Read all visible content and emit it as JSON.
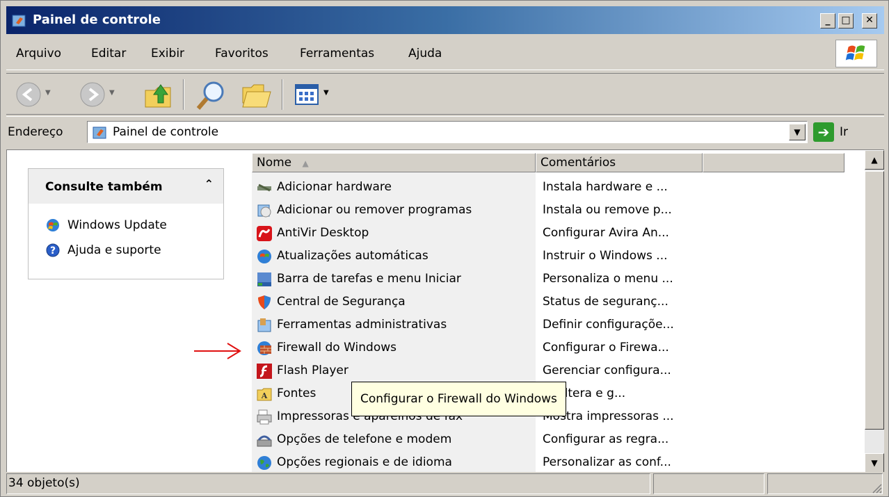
{
  "window": {
    "title": "Painel de controle"
  },
  "menu": [
    "Arquivo",
    "Editar",
    "Exibir",
    "Favoritos",
    "Ferramentas",
    "Ajuda"
  ],
  "toolbar": {
    "icons": [
      "back-icon",
      "forward-icon",
      "up-folder-icon",
      "search-icon",
      "folders-icon",
      "views-icon"
    ]
  },
  "address": {
    "label": "Endereço",
    "value": "Painel de controle",
    "go": "Ir"
  },
  "see_also": {
    "title": "Consulte também",
    "links": [
      "Windows Update",
      "Ajuda e suporte"
    ]
  },
  "columns": {
    "name": "Nome",
    "comments": "Comentários"
  },
  "items": [
    {
      "name": "Adicionar hardware",
      "comment": "Instala hardware e ..."
    },
    {
      "name": "Adicionar ou remover programas",
      "comment": "Instala ou remove p..."
    },
    {
      "name": "AntiVir Desktop",
      "comment": "Configurar Avira An..."
    },
    {
      "name": "Atualizações automáticas",
      "comment": "Instruir o Windows ..."
    },
    {
      "name": "Barra de tarefas e menu Iniciar",
      "comment": "Personaliza o menu ..."
    },
    {
      "name": "Central de Segurança",
      "comment": "Status de seguranç..."
    },
    {
      "name": "Ferramentas administrativas",
      "comment": "Definir configuraçõe..."
    },
    {
      "name": "Firewall do Windows",
      "comment": "Configurar o Firewa..."
    },
    {
      "name": "Flash Player",
      "comment": "Gerenciar configura..."
    },
    {
      "name": "Fontes",
      "comment": "a, altera e g..."
    },
    {
      "name": "Impressoras e aparelhos de fax",
      "comment": "Mostra impressoras ..."
    },
    {
      "name": "Opções de telefone e modem",
      "comment": "Configurar as regra..."
    },
    {
      "name": "Opções regionais e de idioma",
      "comment": "Personalizar as conf..."
    }
  ],
  "tooltip": "Configurar o Firewall do Windows",
  "status": {
    "count": "34 objeto(s)"
  }
}
